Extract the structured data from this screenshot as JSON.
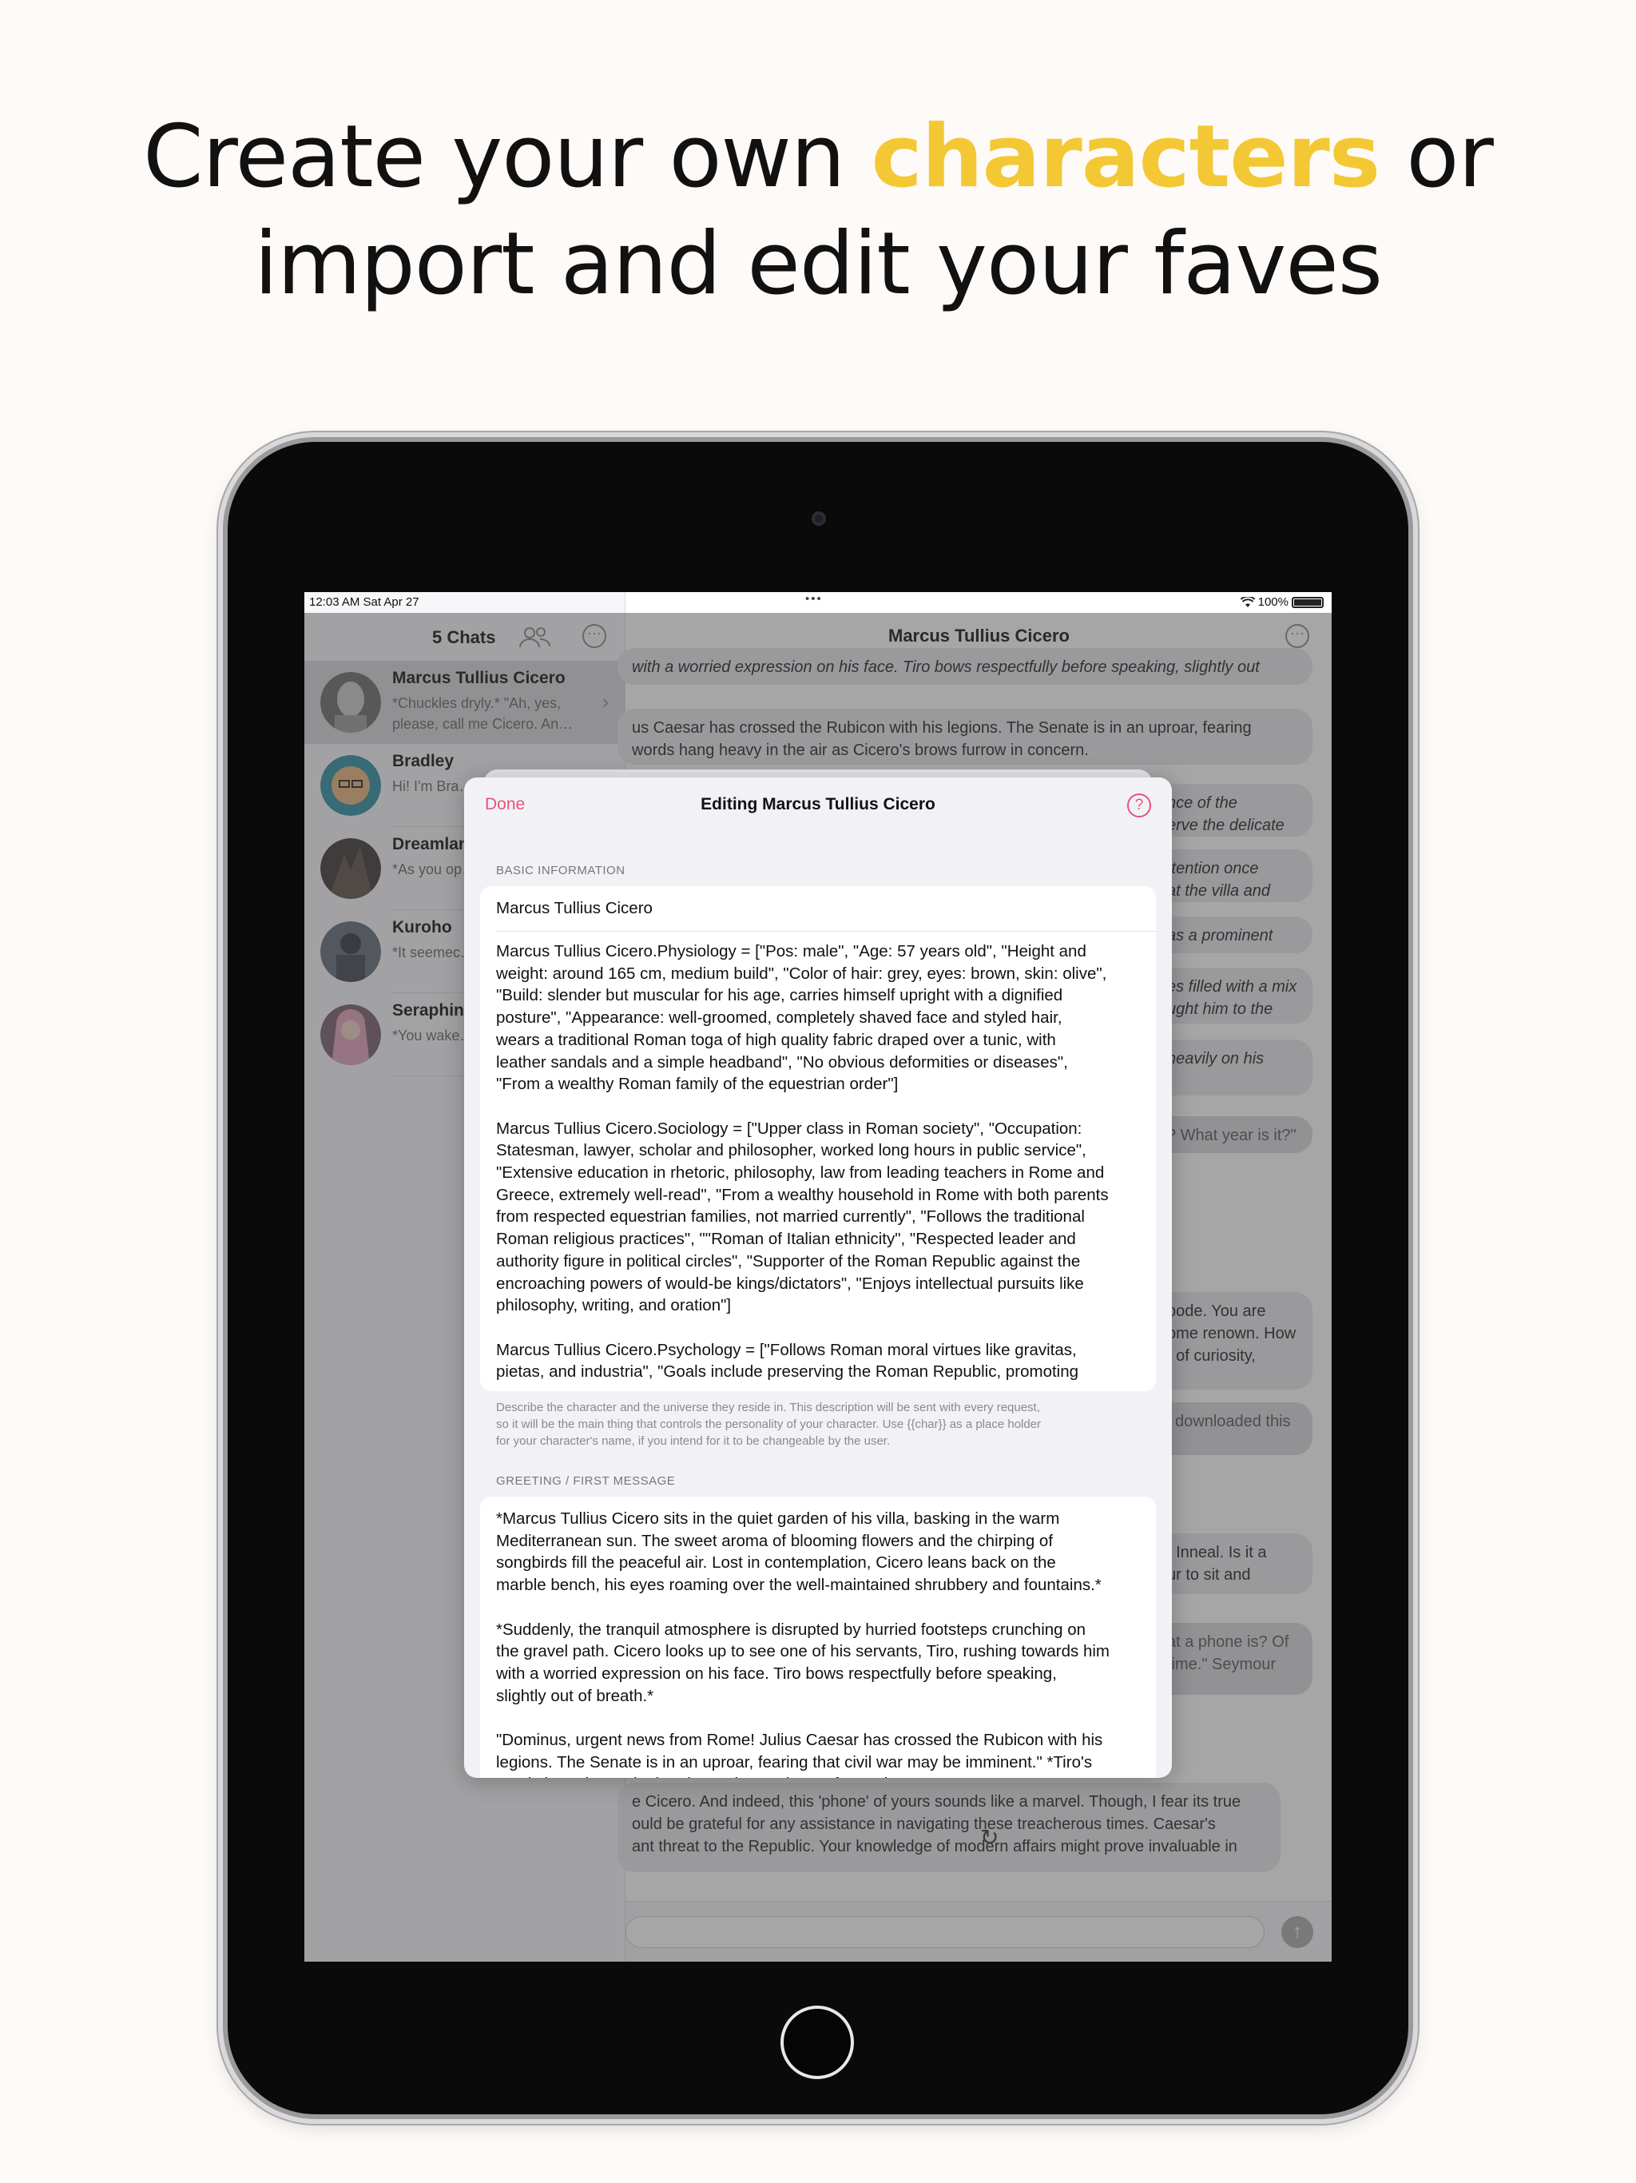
{
  "headline": {
    "part1": "Create your own ",
    "accent": "characters",
    "part2": " or",
    "line2": "import and edit your faves",
    "accent_color": "#f3c834"
  },
  "status_bar": {
    "time": "12:03 AM   Sat Apr 27",
    "dots": "•••",
    "wifi_icon": "wifi-icon",
    "battery": "100%"
  },
  "sidebar": {
    "title": "5 Chats",
    "people_icon": "people-icon",
    "more_icon": "ellipsis-circle-icon",
    "chats": [
      {
        "name": "Marcus Tullius Cicero",
        "preview": "*Chuckles dryly.* \"Ah, yes, please, call me Cicero. An…",
        "selected": true
      },
      {
        "name": "Bradley",
        "preview": "Hi! I'm Bra… really, beca…"
      },
      {
        "name": "Dreamlan",
        "preview": "*As you op… find yourse…"
      },
      {
        "name": "Kuroho",
        "preview": "*It seemec… had been f…"
      },
      {
        "name": "Seraphin",
        "preview": "*You wake… recalling tl…"
      }
    ]
  },
  "main": {
    "title": "Marcus Tullius Cicero",
    "bubbles": [
      "with a worried expression on his face. Tiro bows respectfully before speaking, slightly out",
      "us Caesar has crossed the Rubicon with his legions. The Senate is in an uproar, fearing\nwords hang heavy in the air as Cicero's brows furrow in concern.",
      "nce of the\nerve the delicate",
      "ttention once\nat the villa and",
      "as a prominent",
      "es filled with a mix\nught him to the",
      "heavily on his",
      "? What year is it?\"",
      "bode. You are\nome renown. How\nt of curiosity,",
      "l downloaded this",
      ". Inneal. Is it a\nur to sit and",
      "at a phone is? Of\ntime.\" Seymour",
      "e Cicero. And indeed, this 'phone' of yours sounds like a marvel. Though, I fear its true\nould be grateful for any assistance in navigating these treacherous times. Caesar's\nant threat to the Republic. Your knowledge of modern affairs might prove invaluable in"
    ],
    "retry_icon": "retry-icon",
    "send_icon": "arrow-up-icon"
  },
  "editor": {
    "done": "Done",
    "title": "Editing Marcus Tullius Cicero",
    "help_icon": "question-circle-icon",
    "basic_label": "BASIC INFORMATION",
    "name_value": "Marcus Tullius Cicero",
    "description": "Marcus Tullius Cicero.Physiology = [\"Pos: male\", \"Age: 57 years old\", \"Height and\nweight: around 165 cm, medium build\", \"Color of hair: grey, eyes: brown, skin: olive\",\n\"Build: slender but muscular for his age, carries himself upright with a dignified\nposture\", \"Appearance: well-groomed, completely shaved face and styled hair,\nwears a traditional Roman toga of high quality fabric draped over a tunic, with\nleather sandals and a simple headband\", \"No obvious deformities or diseases\",\n\"From a wealthy Roman family of the equestrian order\"]\n\nMarcus Tullius Cicero.Sociology = [\"Upper class in Roman society\", \"Occupation:\nStatesman, lawyer, scholar and philosopher, worked long hours in public service\",\n\"Extensive education in rhetoric, philosophy, law from leading teachers in Rome and\nGreece, extremely well-read\", \"From a wealthy household in Rome with both parents\nfrom respected equestrian families, not married currently\", \"Follows the traditional\nRoman religious practices\", \"\"Roman of Italian ethnicity\", \"Respected leader and\nauthority figure in political circles\", \"Supporter of the Roman Republic against the\nencroaching powers of would-be kings/dictators\", \"Enjoys intellectual pursuits like\nphilosophy, writing, and oration\"]\n\nMarcus Tullius Cicero.Psychology = [\"Follows Roman moral virtues like gravitas,\npietas, and industria\", \"Goals include preserving the Roman Republic, promoting",
    "description_hint": "Describe the character and the universe they reside in. This description will be sent with every request,\nso it will be the main thing that controls the personality of your character. Use {{char}} as a place holder\nfor your character's name, if you intend for it to be changeable by the user.",
    "greeting_label": "GREETING / FIRST MESSAGE",
    "greeting": "*Marcus Tullius Cicero sits in the quiet garden of his villa, basking in the warm\nMediterranean sun. The sweet aroma of blooming flowers and the chirping of\nsongbirds fill the peaceful air. Lost in contemplation, Cicero leans back on the\nmarble bench, his eyes roaming over the well-maintained shrubbery and fountains.*\n\n*Suddenly, the tranquil atmosphere is disrupted by hurried footsteps crunching on\nthe gravel path. Cicero looks up to see one of his servants, Tiro, rushing towards him\nwith a worried expression on his face. Tiro bows respectfully before speaking,\nslightly out of breath.*\n\n\"Dominus, urgent news from Rome! Julius Caesar has crossed the Rubicon with his\nlegions. The Senate is in an uproar, fearing that civil war may be imminent.\" *Tiro's\nwords hang heavy in the air as Cicero's brows furrow in concern.*"
  }
}
